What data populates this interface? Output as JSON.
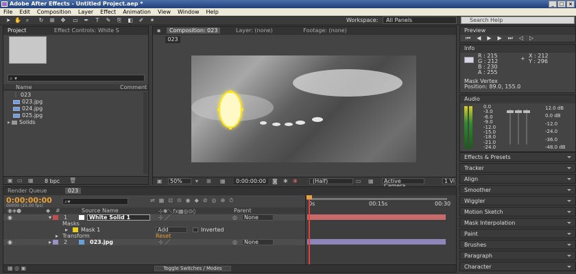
{
  "window": {
    "title": "Adobe After Effects - Untitled Project.aep *"
  },
  "menu": [
    "File",
    "Edit",
    "Composition",
    "Layer",
    "Effect",
    "Animation",
    "View",
    "Window",
    "Help"
  ],
  "toolbar": {
    "workspace_label": "Workspace:",
    "workspace_value": "All Panels",
    "help_search": "Search Help"
  },
  "project": {
    "tabs": [
      "Project",
      "Effect Controls: White S"
    ],
    "search_placeholder": "⌕ ▾",
    "col_name": "Name",
    "col_comment": "Comment",
    "items": [
      "023",
      "023.jpg",
      "024.jpg",
      "025.jpg",
      "Solids"
    ],
    "bpc": "8 bpc"
  },
  "comp": {
    "tabs": [
      "Composition: 023",
      "Layer: (none)",
      "Footage: (none)"
    ],
    "tab_label": "023",
    "zoom": "50%",
    "timecode": "0:00:00:00",
    "resolution": "(Half)",
    "camera": "Active Camera",
    "views": "1 Vi"
  },
  "preview": {
    "title": "Preview"
  },
  "info": {
    "title": "Info",
    "r": "R : 215",
    "g": "G : 212",
    "b": "B : 230",
    "a": "A : 255",
    "x": "X : 212",
    "y": "Y : 296",
    "line1": "Mask Vertex",
    "line2": "Position: 89.0, 155.0"
  },
  "audio": {
    "title": "Audio",
    "left_scale": [
      "0.0",
      "-3.0",
      "-6.0",
      "-9.0",
      "-12.0",
      "-15.0",
      "-18.0",
      "-21.0",
      "-24.0"
    ],
    "right_scale": [
      "12.0 dB",
      "0.0 dB",
      "-12.0",
      "-24.0",
      "-36.0",
      "-48.0 dB"
    ]
  },
  "panels": [
    "Effects & Presets",
    "Tracker",
    "Align",
    "Smoother",
    "Wiggler",
    "Motion Sketch",
    "Mask Interpolation",
    "Paint",
    "Brushes",
    "Paragraph",
    "Character"
  ],
  "timeline": {
    "tabs": [
      "Render Queue",
      "023"
    ],
    "timecode": "0:00:00:00",
    "fps": "00000 (25.00 fps)",
    "col_source": "Source Name",
    "col_parent": "Parent",
    "time_marks": [
      "0s",
      "00:15s",
      "00:30"
    ],
    "layer1_num": "1",
    "layer1_name": "White Solid 1",
    "layer1_parent": "None",
    "masks_label": "Masks",
    "mask1": "Mask 1",
    "mask_mode": "Add",
    "inverted": "Inverted",
    "transform": "Transform",
    "reset": "Reset",
    "layer2_num": "2",
    "layer2_name": "023.jpg",
    "layer2_parent": "None",
    "toggle": "Toggle Switches / Modes"
  },
  "colors": {
    "mask_stroke": "#ffe51a",
    "layer1_bar": "#c96a6a",
    "layer2_bar": "#8e86b8",
    "playhead": "#e04040"
  }
}
